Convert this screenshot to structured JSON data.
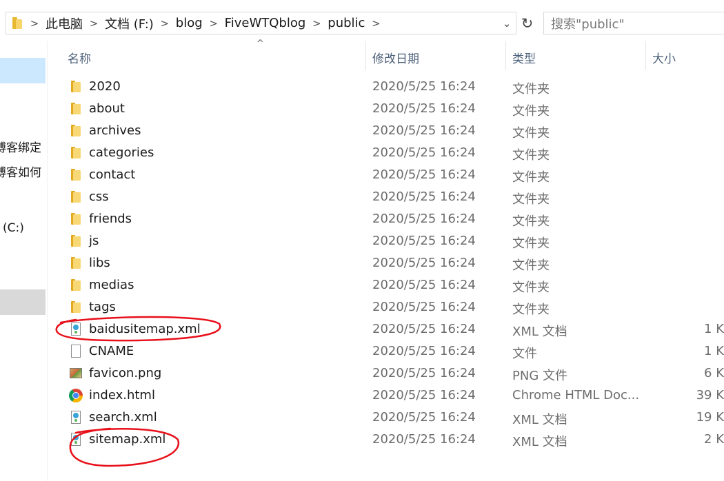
{
  "address_bar": {
    "breadcrumbs": [
      "此电脑",
      "文档 (F:)",
      "blog",
      "FiveWTQblog",
      "public"
    ],
    "dropdown_glyph": "⌄",
    "refresh_glyph": "↻"
  },
  "search": {
    "placeholder": "搜索\"public\""
  },
  "nav_pane": {
    "items": [
      "博客绑定",
      "博客如何",
      "(C:)"
    ]
  },
  "columns": {
    "name": "名称",
    "date": "修改日期",
    "type": "类型",
    "size": "大小"
  },
  "files": [
    {
      "name": "2020",
      "date": "2020/5/25 16:24",
      "type": "文件夹",
      "size": "",
      "icon": "folder-icon"
    },
    {
      "name": "about",
      "date": "2020/5/25 16:24",
      "type": "文件夹",
      "size": "",
      "icon": "folder-icon"
    },
    {
      "name": "archives",
      "date": "2020/5/25 16:24",
      "type": "文件夹",
      "size": "",
      "icon": "folder-icon"
    },
    {
      "name": "categories",
      "date": "2020/5/25 16:24",
      "type": "文件夹",
      "size": "",
      "icon": "folder-icon"
    },
    {
      "name": "contact",
      "date": "2020/5/25 16:24",
      "type": "文件夹",
      "size": "",
      "icon": "folder-icon"
    },
    {
      "name": "css",
      "date": "2020/5/25 16:24",
      "type": "文件夹",
      "size": "",
      "icon": "folder-icon"
    },
    {
      "name": "friends",
      "date": "2020/5/25 16:24",
      "type": "文件夹",
      "size": "",
      "icon": "folder-icon"
    },
    {
      "name": "js",
      "date": "2020/5/25 16:24",
      "type": "文件夹",
      "size": "",
      "icon": "folder-icon"
    },
    {
      "name": "libs",
      "date": "2020/5/25 16:24",
      "type": "文件夹",
      "size": "",
      "icon": "folder-icon"
    },
    {
      "name": "medias",
      "date": "2020/5/25 16:24",
      "type": "文件夹",
      "size": "",
      "icon": "folder-icon"
    },
    {
      "name": "tags",
      "date": "2020/5/25 16:24",
      "type": "文件夹",
      "size": "",
      "icon": "folder-icon"
    },
    {
      "name": "baidusitemap.xml",
      "date": "2020/5/25 16:24",
      "type": "XML 文档",
      "size": "1 K",
      "icon": "xml-file-icon"
    },
    {
      "name": "CNAME",
      "date": "2020/5/25 16:24",
      "type": "文件",
      "size": "1 K",
      "icon": "file-icon"
    },
    {
      "name": "favicon.png",
      "date": "2020/5/25 16:24",
      "type": "PNG 文件",
      "size": "6 K",
      "icon": "png-file-icon"
    },
    {
      "name": "index.html",
      "date": "2020/5/25 16:24",
      "type": "Chrome HTML Doc...",
      "size": "39 K",
      "icon": "chrome-icon"
    },
    {
      "name": "search.xml",
      "date": "2020/5/25 16:24",
      "type": "XML 文档",
      "size": "19 K",
      "icon": "xml-file-icon"
    },
    {
      "name": "sitemap.xml",
      "date": "2020/5/25 16:24",
      "type": "XML 文档",
      "size": "2 K",
      "icon": "xml-file-icon"
    }
  ],
  "colors": {
    "header_text": "#4c607a",
    "annotation": "#e8101a",
    "nav_selected": "#cce8ff"
  }
}
